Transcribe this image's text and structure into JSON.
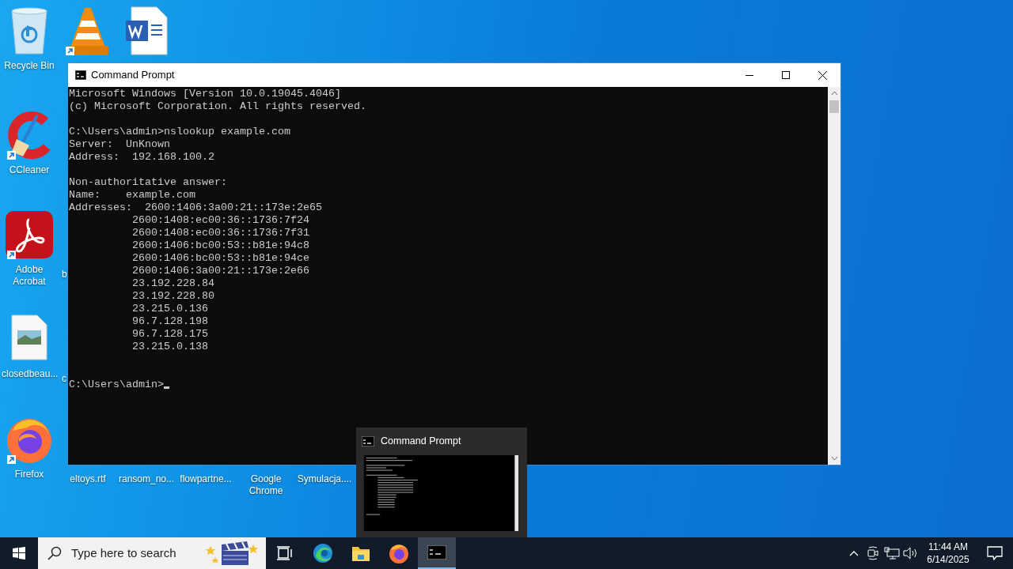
{
  "desktop_icons": [
    {
      "kind": "recycle-bin",
      "label": "Recycle Bin",
      "shortcut": false
    },
    {
      "kind": "ccleaner",
      "label": "CCleaner",
      "shortcut": true
    },
    {
      "kind": "acrobat",
      "label": "Adobe Acrobat",
      "shortcut": true
    },
    {
      "kind": "image-file",
      "label": "closedbeau...",
      "shortcut": false
    },
    {
      "kind": "firefox",
      "label": "Firefox",
      "shortcut": true
    },
    {
      "kind": "vlc",
      "shortcut": true
    },
    {
      "kind": "covered",
      "label": "b"
    },
    {
      "kind": "covered",
      "label": "c"
    },
    {
      "kind": "covered",
      "label": "eltoys.rtf"
    },
    {
      "kind": "word",
      "shortcut": false
    },
    {
      "kind": "covered",
      "label": "ransom_no..."
    },
    {
      "kind": "covered",
      "label": "flowpartne..."
    },
    {
      "kind": "covered",
      "label": "Google Chrome"
    },
    {
      "kind": "covered",
      "label": "Symulacja...."
    }
  ],
  "window": {
    "title": "Command Prompt",
    "console": {
      "blocks": [
        [
          "Microsoft Windows [Version 10.0.19045.4046]",
          "(c) Microsoft Corporation. All rights reserved."
        ],
        [
          "C:\\Users\\admin>nslookup example.com",
          "Server:  UnKnown",
          "Address:  192.168.100.2"
        ],
        [
          "Non-authoritative answer:",
          "Name:    example.com",
          "Addresses:  2600:1406:3a00:21::173e:2e65",
          "          2600:1408:ec00:36::1736:7f24",
          "          2600:1408:ec00:36::1736:7f31",
          "          2600:1406:bc00:53::b81e:94c8",
          "          2600:1406:bc00:53::b81e:94ce",
          "          2600:1406:3a00:21::173e:2e66",
          "          23.192.228.84",
          "          23.192.228.80",
          "          23.215.0.136",
          "          96.7.128.198",
          "          96.7.128.175",
          "          23.215.0.138"
        ]
      ],
      "prompt": "C:\\Users\\admin>"
    }
  },
  "taskbar_preview": {
    "title": "Command Prompt"
  },
  "taskbar": {
    "search": {
      "placeholder": "Type here to search"
    },
    "apps": [
      {
        "kind": "task-view",
        "active": false
      },
      {
        "kind": "edge",
        "active": false
      },
      {
        "kind": "explorer",
        "active": false
      },
      {
        "kind": "firefox",
        "active": false
      },
      {
        "kind": "terminal",
        "active": true
      }
    ],
    "clock": {
      "time": "11:44 AM",
      "date": "6/14/2025"
    }
  }
}
